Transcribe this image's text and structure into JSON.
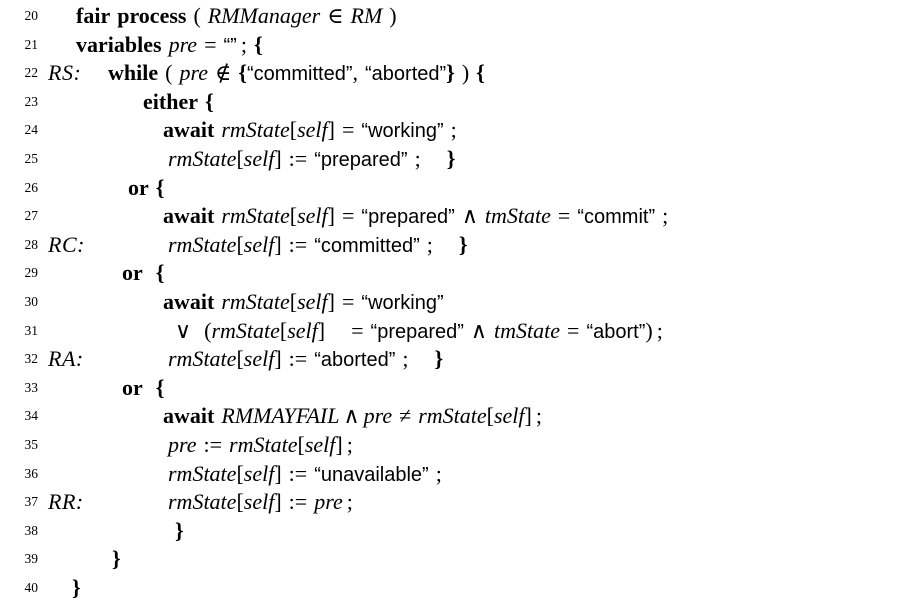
{
  "document": {
    "kind": "pluscal-algorithm-listing",
    "title": "fair process RMManager",
    "background_color": "#ffffff",
    "text_color": "#000000",
    "first_line_number": 20,
    "last_line_number": 40
  },
  "keywords": {
    "fair": "fair",
    "process": "process",
    "variables": "variables",
    "while": "while",
    "either": "either",
    "or": "or",
    "await": "await"
  },
  "identifiers": {
    "rmmanager": "RMManager",
    "rm": "RM",
    "pre": "pre",
    "rmstate": "rmState",
    "self": "self",
    "tmstate": "tmState",
    "rmmayfail": "RMMAYFAIL"
  },
  "strings": {
    "empty": "“”",
    "committed": "“committed”",
    "aborted": "“aborted”",
    "working": "“working”",
    "prepared": "“prepared”",
    "commit": "“commit”",
    "abort": "“abort”",
    "unavailable": "“unavailable”"
  },
  "operators": {
    "in": "∈",
    "notin": "∉",
    "and": "∧",
    "or": "∨",
    "eq": "=",
    "neq": "≠",
    "assign": ":=",
    "semi": ";",
    "comma": ",",
    "colon": ":",
    "lbrace": "{",
    "rbrace": "}",
    "lparen": "(",
    "rparen": ")",
    "lbracket": "[",
    "rbracket": "]"
  },
  "labels": {
    "rs": "RS:",
    "rc": "RC:",
    "ra": "RA:",
    "rr": "RR:"
  },
  "line_numbers": {
    "n20": "20",
    "n21": "21",
    "n22": "22",
    "n23": "23",
    "n24": "24",
    "n25": "25",
    "n26": "26",
    "n27": "27",
    "n28": "28",
    "n29": "29",
    "n30": "30",
    "n31": "31",
    "n32": "32",
    "n33": "33",
    "n34": "34",
    "n35": "35",
    "n36": "36",
    "n37": "37",
    "n38": "38",
    "n39": "39",
    "n40": "40"
  },
  "lines": [
    {
      "number": "20",
      "label": "",
      "text": "fair process ( RMManager ∈ RM )"
    },
    {
      "number": "21",
      "label": "",
      "text": "variables pre = “” ; {"
    },
    {
      "number": "22",
      "label": "RS:",
      "text": "while ( pre ∉ {“committed”, “aborted”} ) {"
    },
    {
      "number": "23",
      "label": "",
      "text": "either {"
    },
    {
      "number": "24",
      "label": "",
      "text": "await rmState[self] = “working” ;"
    },
    {
      "number": "25",
      "label": "",
      "text": "rmState[self] := “prepared” ;  }"
    },
    {
      "number": "26",
      "label": "",
      "text": "or {"
    },
    {
      "number": "27",
      "label": "",
      "text": "await rmState[self] = “prepared” ∧ tmState = “commit” ;"
    },
    {
      "number": "28",
      "label": "RC:",
      "text": "rmState[self] := “committed” ;  }"
    },
    {
      "number": "29",
      "label": "",
      "text": "or {"
    },
    {
      "number": "30",
      "label": "",
      "text": "await rmState[self] = “working”"
    },
    {
      "number": "31",
      "label": "",
      "text": "∨ (rmState[self]  = “prepared” ∧ tmState = “abort”) ;"
    },
    {
      "number": "32",
      "label": "RA:",
      "text": "rmState[self] := “aborted” ;  }"
    },
    {
      "number": "33",
      "label": "",
      "text": "or {"
    },
    {
      "number": "34",
      "label": "",
      "text": "await RMMAYFAIL ∧ pre ≠ rmState[self] ;"
    },
    {
      "number": "35",
      "label": "",
      "text": "pre := rmState[self] ;"
    },
    {
      "number": "36",
      "label": "",
      "text": "rmState[self] := “unavailable” ;"
    },
    {
      "number": "37",
      "label": "RR:",
      "text": "rmState[self] := pre ;"
    },
    {
      "number": "38",
      "label": "",
      "text": "}"
    },
    {
      "number": "39",
      "label": "",
      "text": "}"
    },
    {
      "number": "40",
      "label": "",
      "text": "}"
    }
  ]
}
